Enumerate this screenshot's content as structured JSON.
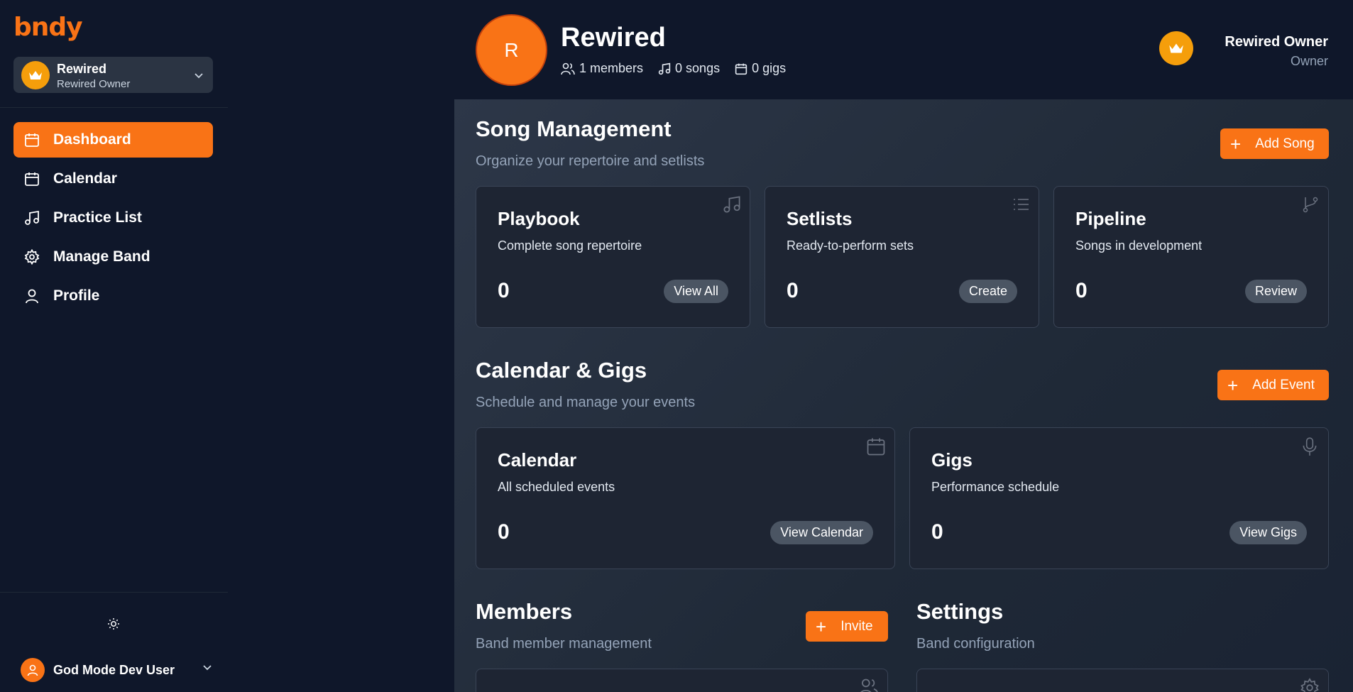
{
  "app": {
    "logo": "bndy"
  },
  "band_switcher": {
    "name": "Rewired",
    "role": "Rewired Owner"
  },
  "sidebar": {
    "items": [
      {
        "label": "Dashboard",
        "icon": "calendar-icon",
        "active": true
      },
      {
        "label": "Calendar",
        "icon": "calendar-icon",
        "active": false
      },
      {
        "label": "Practice List",
        "icon": "music-note-icon",
        "active": false
      },
      {
        "label": "Manage Band",
        "icon": "gear-icon",
        "active": false
      },
      {
        "label": "Profile",
        "icon": "user-icon",
        "active": false
      }
    ]
  },
  "user": {
    "name": "God Mode Dev User"
  },
  "header": {
    "avatar_letter": "R",
    "band_name": "Rewired",
    "members": "1 members",
    "songs": "0 songs",
    "gigs": "0 gigs",
    "owner_name": "Rewired Owner",
    "owner_role": "Owner"
  },
  "song_management": {
    "title": "Song Management",
    "subtitle": "Organize your repertoire and setlists",
    "add_label": "Add Song",
    "cards": [
      {
        "title": "Playbook",
        "subtitle": "Complete song repertoire",
        "count": "0",
        "button": "View All",
        "icon": "music-note-icon"
      },
      {
        "title": "Setlists",
        "subtitle": "Ready-to-perform sets",
        "count": "0",
        "button": "Create",
        "icon": "list-icon"
      },
      {
        "title": "Pipeline",
        "subtitle": "Songs in development",
        "count": "0",
        "button": "Review",
        "icon": "git-branch-icon"
      }
    ]
  },
  "calendar_gigs": {
    "title": "Calendar & Gigs",
    "subtitle": "Schedule and manage your events",
    "add_label": "Add Event",
    "cards": [
      {
        "title": "Calendar",
        "subtitle": "All scheduled events",
        "count": "0",
        "button": "View Calendar",
        "icon": "calendar-icon"
      },
      {
        "title": "Gigs",
        "subtitle": "Performance schedule",
        "count": "0",
        "button": "View Gigs",
        "icon": "microphone-icon"
      }
    ]
  },
  "members": {
    "title": "Members",
    "subtitle": "Band member management",
    "invite_label": "Invite"
  },
  "settings": {
    "title": "Settings",
    "subtitle": "Band configuration"
  },
  "colors": {
    "accent": "#f97316",
    "crown": "#f59e0b",
    "bg": "#0f172a"
  }
}
